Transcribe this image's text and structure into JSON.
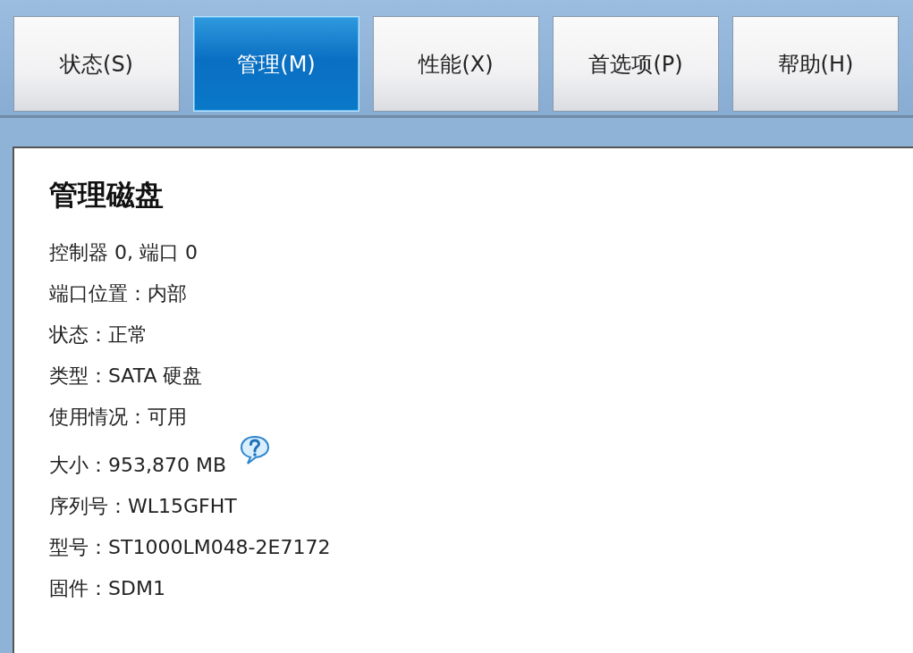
{
  "tabs": [
    {
      "label": "状态(S)",
      "selected": false
    },
    {
      "label": "管理(M)",
      "selected": true
    },
    {
      "label": "性能(X)",
      "selected": false
    },
    {
      "label": "首选项(P)",
      "selected": false
    },
    {
      "label": "帮助(H)",
      "selected": false
    }
  ],
  "panel": {
    "title": "管理磁盘",
    "lines": [
      {
        "kind": "text",
        "text": "控制器 0, 端口 0"
      },
      {
        "kind": "text",
        "text": "端口位置：内部"
      },
      {
        "kind": "text",
        "text": "状态：正常"
      },
      {
        "kind": "text",
        "text": "类型：SATA 硬盘"
      },
      {
        "kind": "text",
        "text": "使用情况：可用"
      },
      {
        "kind": "help",
        "text": "大小：953,870 MB"
      },
      {
        "kind": "text",
        "text": "序列号：WL15GFHT"
      },
      {
        "kind": "text",
        "text": "型号：ST1000LM048-2E7172"
      },
      {
        "kind": "text",
        "text": "固件：SDM1"
      }
    ]
  }
}
